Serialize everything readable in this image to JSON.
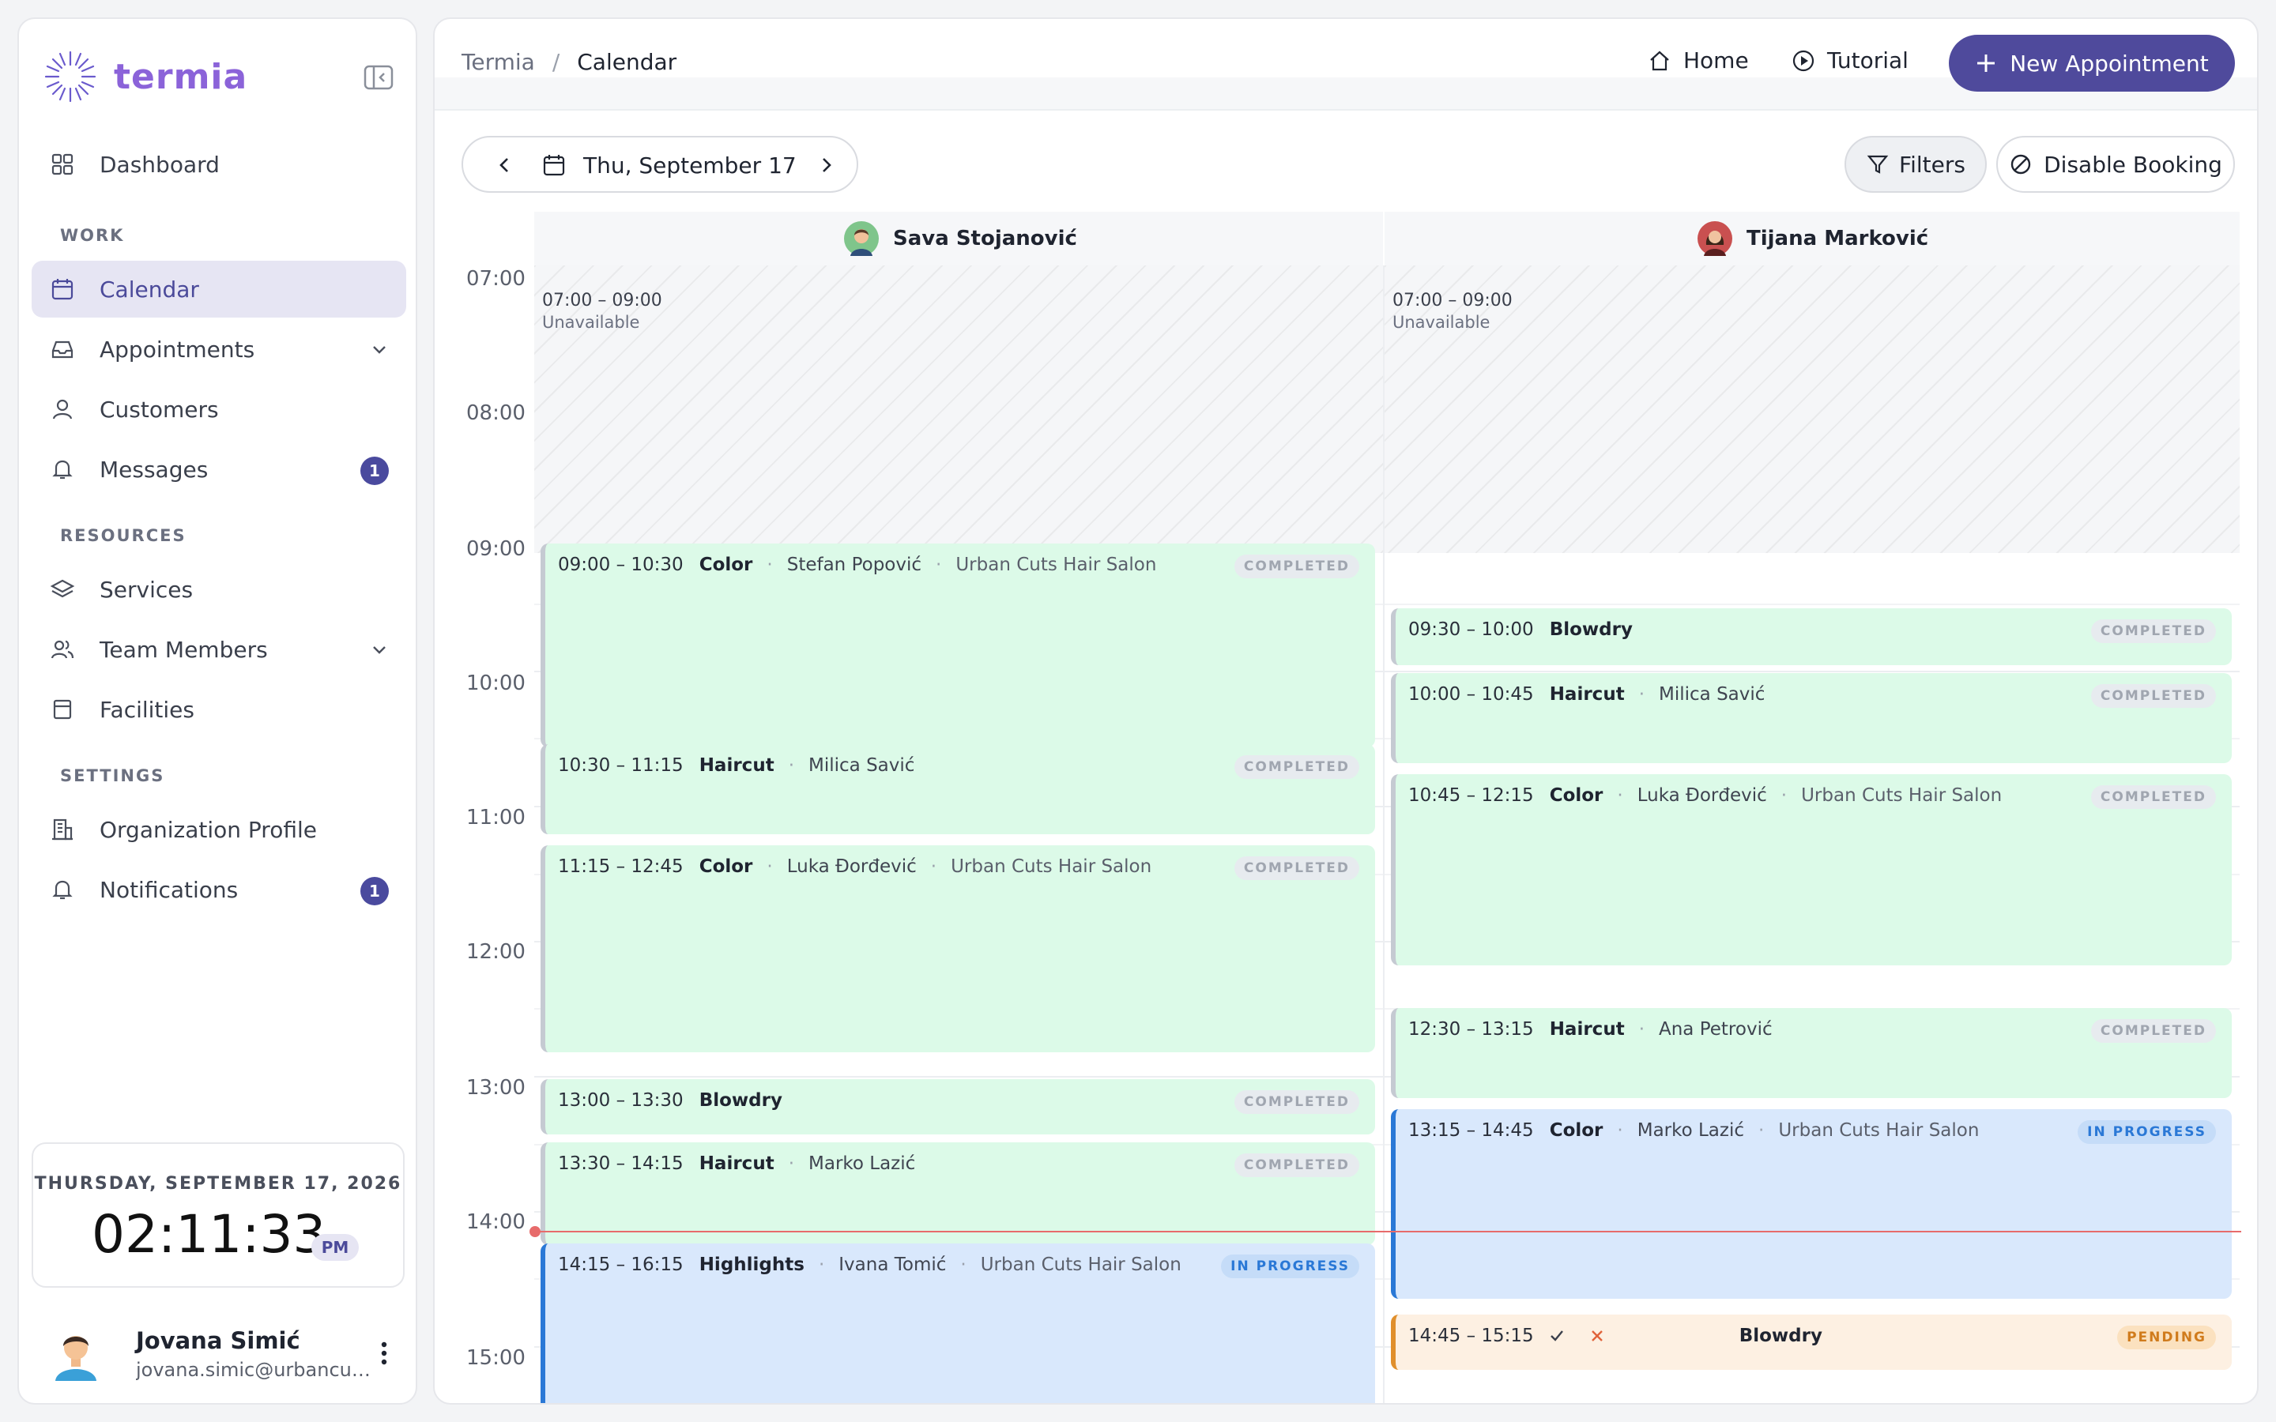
{
  "brand": {
    "name": "termia"
  },
  "sidebar": {
    "sections": {
      "work": "WORK",
      "resources": "RESOURCES",
      "settings": "SETTINGS"
    },
    "items": {
      "dashboard": "Dashboard",
      "calendar": "Calendar",
      "appointments": "Appointments",
      "customers": "Customers",
      "messages": "Messages",
      "services": "Services",
      "team_members": "Team Members",
      "facilities": "Facilities",
      "organization_profile": "Organization Profile",
      "notifications": "Notifications"
    },
    "badges": {
      "messages": "1",
      "notifications": "1"
    },
    "active": "calendar"
  },
  "clock": {
    "date": "THURSDAY, SEPTEMBER 17, 2026",
    "time": "02:11:33",
    "ampm": "PM"
  },
  "user": {
    "name": "Jovana Simić",
    "email": "jovana.simic@urbancuts..."
  },
  "header": {
    "breadcrumb": [
      "Termia",
      "/",
      "Calendar"
    ],
    "home": "Home",
    "tutorial": "Tutorial",
    "new_appointment": "New Appointment"
  },
  "toolbar": {
    "date": "Thu, September 17",
    "filters": "Filters",
    "disable_booking": "Disable Booking"
  },
  "hours": [
    "07:00",
    "08:00",
    "09:00",
    "10:00",
    "11:00",
    "12:00",
    "13:00",
    "14:00",
    "15:00"
  ],
  "staff": [
    {
      "name": "Sava Stojanović",
      "unavailable": {
        "range": "07:00 – 09:00",
        "label": "Unavailable"
      },
      "appointments": [
        {
          "time": "09:00 – 10:30",
          "service": "Color",
          "customer": "Stefan Popović",
          "location": "Urban Cuts Hair Salon",
          "status": "COMPLETED"
        },
        {
          "time": "10:30 – 11:15",
          "service": "Haircut",
          "customer": "Milica Savić",
          "location": "",
          "status": "COMPLETED"
        },
        {
          "time": "11:15 – 12:45",
          "service": "Color",
          "customer": "Luka Đorđević",
          "location": "Urban Cuts Hair Salon",
          "status": "COMPLETED"
        },
        {
          "time": "13:00 – 13:30",
          "service": "Blowdry",
          "customer": "",
          "location": "",
          "status": "COMPLETED"
        },
        {
          "time": "13:30 – 14:15",
          "service": "Haircut",
          "customer": "Marko Lazić",
          "location": "",
          "status": "COMPLETED"
        },
        {
          "time": "14:15 – 16:15",
          "service": "Highlights",
          "customer": "Ivana Tomić",
          "location": "Urban Cuts Hair Salon",
          "status": "IN PROGRESS"
        }
      ]
    },
    {
      "name": "Tijana Marković",
      "unavailable": {
        "range": "07:00 – 09:00",
        "label": "Unavailable"
      },
      "appointments": [
        {
          "time": "09:30 – 10:00",
          "service": "Blowdry",
          "customer": "",
          "location": "",
          "status": "COMPLETED"
        },
        {
          "time": "10:00 – 10:45",
          "service": "Haircut",
          "customer": "Milica Savić",
          "location": "",
          "status": "COMPLETED"
        },
        {
          "time": "10:45 – 12:15",
          "service": "Color",
          "customer": "Luka Đorđević",
          "location": "Urban Cuts Hair Salon",
          "status": "COMPLETED"
        },
        {
          "time": "12:30 – 13:15",
          "service": "Haircut",
          "customer": "Ana Petrović",
          "location": "",
          "status": "COMPLETED"
        },
        {
          "time": "13:15 – 14:45",
          "service": "Color",
          "customer": "Marko Lazić",
          "location": "Urban Cuts Hair Salon",
          "status": "IN PROGRESS"
        },
        {
          "time": "14:45 – 15:15",
          "service": "Blowdry",
          "customer": "",
          "location": "",
          "status": "PENDING"
        }
      ]
    }
  ],
  "colors": {
    "accent": "#4f4a9c",
    "brand": "#8b63d9",
    "completed_bg": "#dcfae8",
    "in_progress": "#2a78d6",
    "pending": "#e08f2c",
    "now_line": "#e76b6b"
  },
  "icons": {
    "dashboard": "grid-icon",
    "calendar": "calendar-icon",
    "appointments": "inbox-icon",
    "customers": "user-icon",
    "messages": "bell-icon",
    "services": "layers-icon",
    "team_members": "users-icon",
    "facilities": "box-icon",
    "organization_profile": "building-icon",
    "notifications": "bell-icon"
  }
}
